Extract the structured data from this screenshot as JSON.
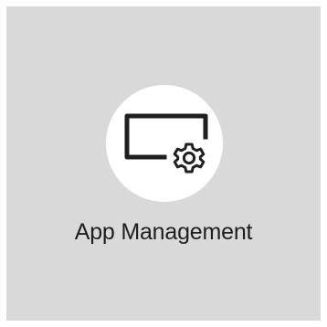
{
  "tile": {
    "label": "App Management",
    "icon": "app-management-icon"
  },
  "colors": {
    "tile_background": "#d9d9d9",
    "circle_background": "#ffffff",
    "icon_stroke": "#1f1f1f",
    "label_text": "#1f1f1f"
  }
}
